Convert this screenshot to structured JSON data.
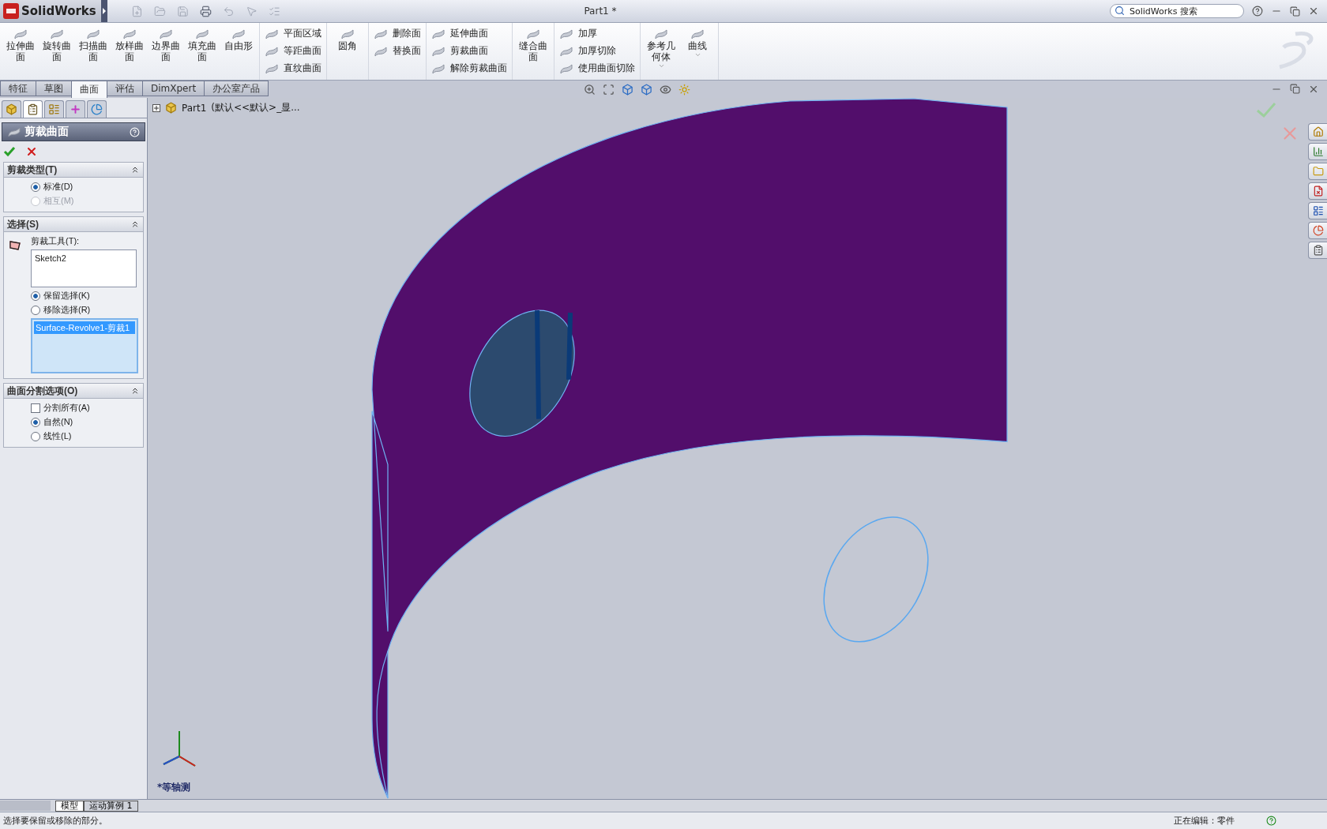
{
  "title_bar": {
    "app_name": "SolidWorks",
    "document_title": "Part1 *",
    "search": {
      "placeholder": "SolidWorks 搜索"
    }
  },
  "command_manager": {
    "groups": [
      {
        "kind": "large",
        "items": [
          "拉伸曲面",
          "旋转曲面",
          "扫描曲面",
          "放样曲面",
          "边界曲面",
          "填充曲面",
          "自由形"
        ]
      },
      {
        "kind": "small",
        "items": [
          "平面区域",
          "等距曲面",
          "直纹曲面"
        ]
      },
      {
        "kind": "large",
        "items": [
          "圆角"
        ]
      },
      {
        "kind": "small",
        "items": [
          "删除面",
          "替换面"
        ]
      },
      {
        "kind": "small",
        "items": [
          "延伸曲面",
          "剪裁曲面",
          "解除剪裁曲面"
        ]
      },
      {
        "kind": "large",
        "items": [
          "缝合曲面"
        ]
      },
      {
        "kind": "small",
        "items": [
          "加厚",
          "加厚切除",
          "使用曲面切除"
        ]
      },
      {
        "kind": "dropdown",
        "items": [
          "参考几何体",
          "曲线"
        ]
      }
    ]
  },
  "tabs": [
    {
      "label": "特征",
      "selected": false
    },
    {
      "label": "草图",
      "selected": false
    },
    {
      "label": "曲面",
      "selected": true
    },
    {
      "label": "评估",
      "selected": false
    },
    {
      "label": "DimXpert",
      "selected": false
    },
    {
      "label": "办公室产品",
      "selected": false
    }
  ],
  "property_manager": {
    "panel_tabs": [
      {
        "kind": "features",
        "selected": false
      },
      {
        "kind": "properties",
        "selected": true
      },
      {
        "kind": "configurations",
        "selected": false
      },
      {
        "kind": "dimxpert",
        "selected": false
      },
      {
        "kind": "display",
        "selected": false
      }
    ],
    "title": "剪裁曲面",
    "sections": [
      {
        "title": "剪裁类型(T)",
        "items": [
          {
            "kind": "radio",
            "label": "标准(D)",
            "selected": true,
            "disabled": false
          },
          {
            "kind": "radio",
            "label": "相互(M)",
            "selected": false,
            "disabled": true
          }
        ]
      },
      {
        "title": "选择(S)",
        "items": [
          {
            "kind": "label",
            "label": "剪裁工具(T):"
          },
          {
            "kind": "list",
            "entries": [
              {
                "label": "Sketch2",
                "selected": false
              }
            ]
          },
          {
            "kind": "radio",
            "label": "保留选择(K)",
            "selected": true,
            "disabled": false
          },
          {
            "kind": "radio",
            "label": "移除选择(R)",
            "selected": false,
            "disabled": false
          },
          {
            "kind": "list",
            "entries": [
              {
                "label": "Surface-Revolve1-剪裁1",
                "selected": true
              }
            ]
          }
        ]
      },
      {
        "title": "曲面分割选项(O)",
        "items": [
          {
            "kind": "checkbox",
            "label": "分割所有(A)",
            "checked": false
          },
          {
            "kind": "radio",
            "label": "自然(N)",
            "selected": true,
            "disabled": false
          },
          {
            "kind": "radio",
            "label": "线性(L)",
            "selected": false,
            "disabled": false
          }
        ]
      }
    ]
  },
  "feature_tree": {
    "name": "Part1",
    "configuration": "(默认<<默认>_显..."
  },
  "viewport": {
    "view_label": "*等轴测"
  },
  "bottom_tabs": [
    {
      "label": "模型",
      "selected": true
    },
    {
      "label": "运动算例 1",
      "selected": false
    }
  ],
  "status_bar": {
    "message": "选择要保留或移除的部分。",
    "edit_state": "正在编辑：零件"
  }
}
